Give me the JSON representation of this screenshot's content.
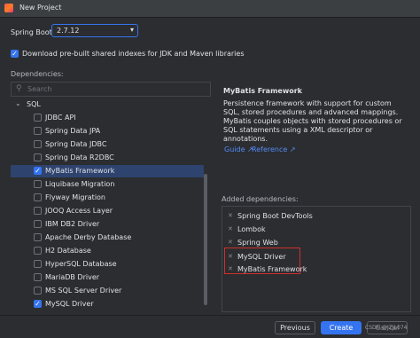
{
  "window": {
    "title": "New Project"
  },
  "spring_boot": {
    "label": "Spring Boot:",
    "selected": "2.7.12"
  },
  "download_option": {
    "label": "Download pre-built shared indexes for JDK and Maven libraries",
    "checked": true
  },
  "dependencies": {
    "heading": "Dependencies:",
    "search_placeholder": "Search",
    "group": "SQL",
    "items": [
      {
        "label": "JDBC API",
        "checked": false,
        "selected": false
      },
      {
        "label": "Spring Data JPA",
        "checked": false,
        "selected": false
      },
      {
        "label": "Spring Data JDBC",
        "checked": false,
        "selected": false
      },
      {
        "label": "Spring Data R2DBC",
        "checked": false,
        "selected": false
      },
      {
        "label": "MyBatis Framework",
        "checked": true,
        "selected": true
      },
      {
        "label": "Liquibase Migration",
        "checked": false,
        "selected": false
      },
      {
        "label": "Flyway Migration",
        "checked": false,
        "selected": false
      },
      {
        "label": "JOOQ Access Layer",
        "checked": false,
        "selected": false
      },
      {
        "label": "IBM DB2 Driver",
        "checked": false,
        "selected": false
      },
      {
        "label": "Apache Derby Database",
        "checked": false,
        "selected": false
      },
      {
        "label": "H2 Database",
        "checked": false,
        "selected": false
      },
      {
        "label": "HyperSQL Database",
        "checked": false,
        "selected": false
      },
      {
        "label": "MariaDB Driver",
        "checked": false,
        "selected": false
      },
      {
        "label": "MS SQL Server Driver",
        "checked": false,
        "selected": false
      },
      {
        "label": "MySQL Driver",
        "checked": true,
        "selected": false
      }
    ]
  },
  "details": {
    "title": "MyBatis Framework",
    "description": "Persistence framework with support for custom SQL, stored procedures and advanced mappings. MyBatis couples objects with stored procedures or SQL statements using a XML descriptor or annotations.",
    "links": [
      "Guide",
      "Reference"
    ]
  },
  "added": {
    "heading": "Added dependencies:",
    "items": [
      "Spring Boot DevTools",
      "Lombok",
      "Spring Web",
      "MySQL Driver",
      "MyBatis Framework"
    ]
  },
  "buttons": {
    "previous": "Previous",
    "create": "Create",
    "cancel": "Cancel"
  },
  "watermark": "CSDN @JZJL074",
  "colors": {
    "accent": "#3574f0",
    "selection": "#2e436e",
    "highlight": "#d12f2f",
    "link": "#548af7"
  }
}
